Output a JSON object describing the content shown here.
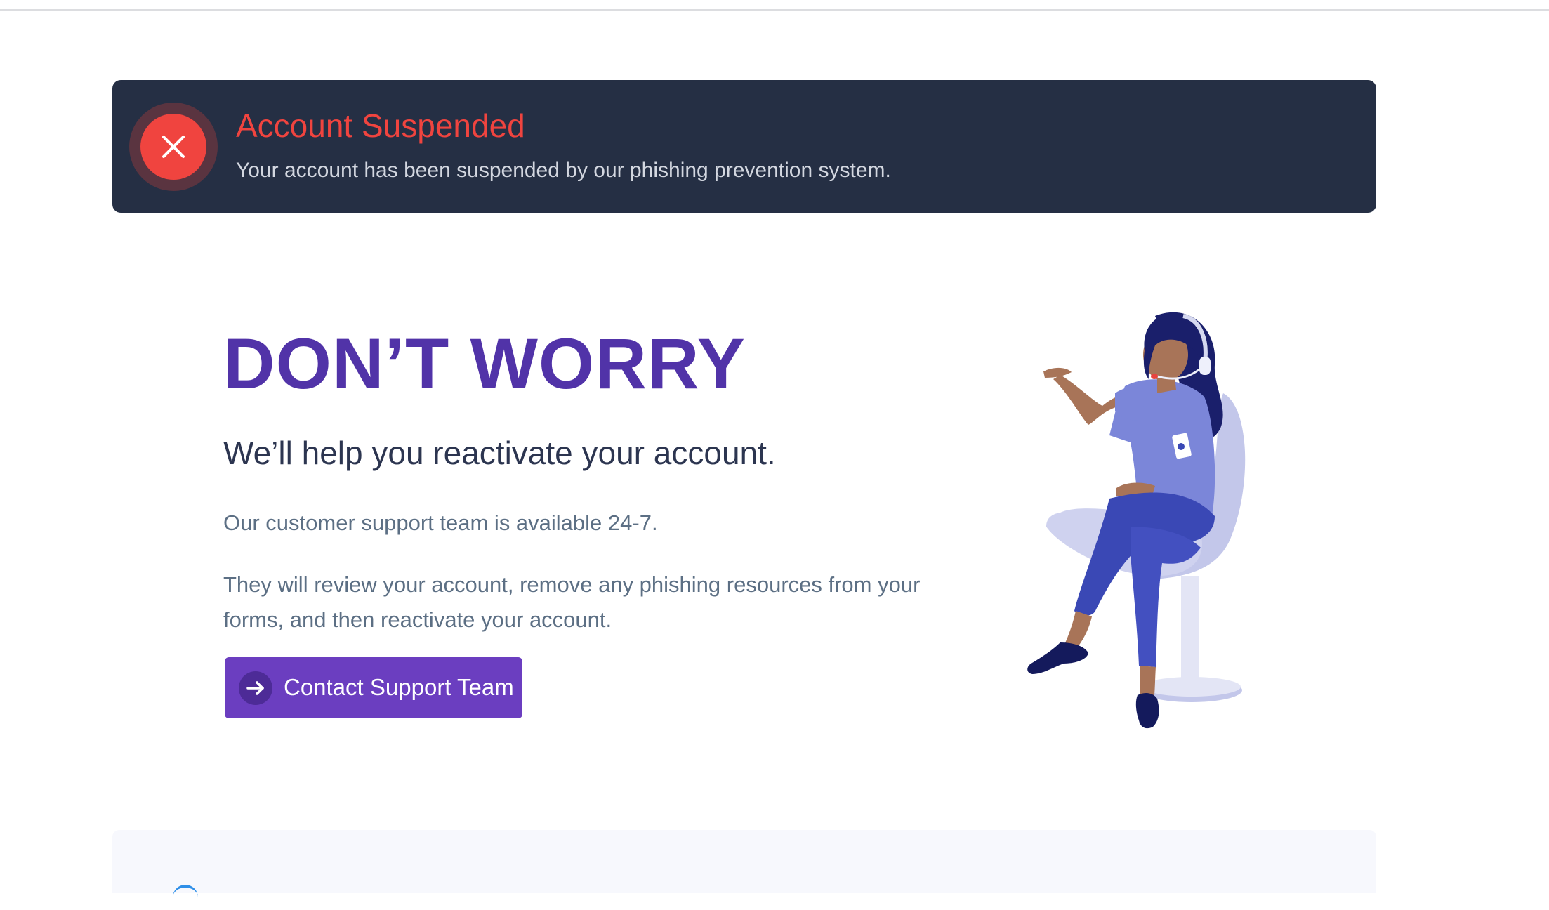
{
  "alert": {
    "title": "Account Suspended",
    "message": "Your account has been suspended by our phishing prevention system.",
    "icon": "close-icon",
    "colors": {
      "background": "#252f44",
      "accent": "#f0443f"
    }
  },
  "main": {
    "headline": "DON’T WORRY",
    "subheadline": "We’ll help you reactivate your account.",
    "paragraph1": "Our customer support team is available 24-7.",
    "paragraph2": "They will review your account, remove any phishing resources from your forms, and then reactivate your account.",
    "cta": {
      "label": "Contact Support Team",
      "icon": "arrow-right-icon"
    },
    "colors": {
      "headline": "#5133a8",
      "button": "#6b3ec0"
    }
  },
  "illustration": {
    "icon": "support-agent-illustration"
  }
}
